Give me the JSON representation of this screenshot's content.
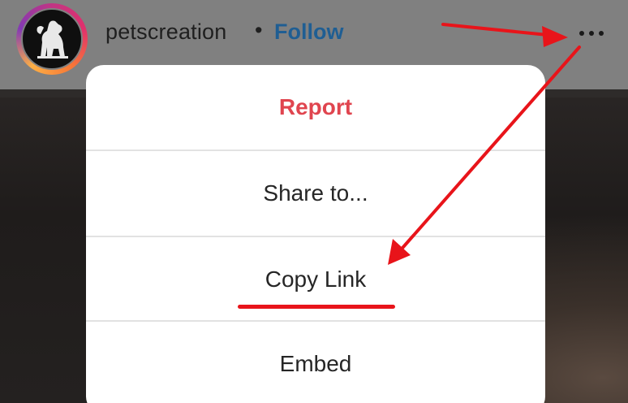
{
  "post_header": {
    "avatar_icon": "dog-silhouette-icon",
    "username": "petscreation",
    "separator": "•",
    "follow_label": "Follow",
    "more_icon": "more-options-icon"
  },
  "menu": {
    "items": [
      {
        "label": "Report",
        "color": "#e0454f"
      },
      {
        "label": "Share to..."
      },
      {
        "label": "Copy Link"
      },
      {
        "label": "Embed"
      }
    ]
  },
  "annotations": {
    "arrow_color": "#e8141a",
    "highlighted_item": "Copy Link"
  }
}
